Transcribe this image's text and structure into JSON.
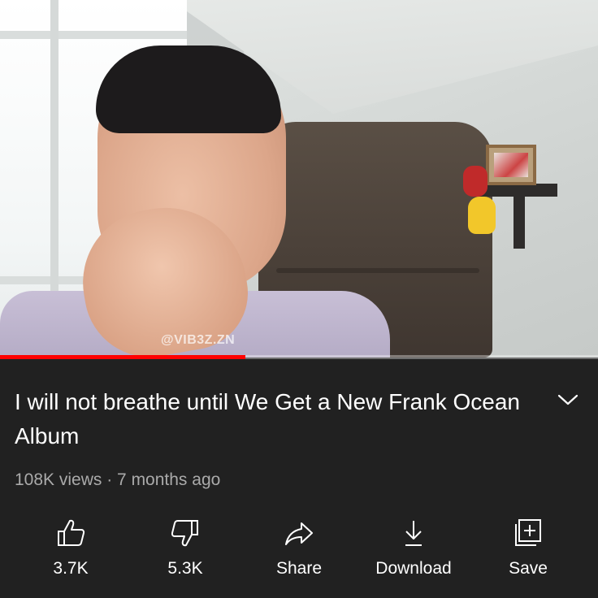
{
  "video": {
    "watermark": "@VIB3Z.ZN",
    "progress_fraction": 0.41
  },
  "info": {
    "title": "I will not breathe until We Get a New Frank Ocean Album",
    "meta": "108K views · 7 months ago",
    "expand_icon": "chevron-down-icon"
  },
  "actions": [
    {
      "label": "3.7K",
      "icon": "thumbs-up-icon"
    },
    {
      "label": "5.3K",
      "icon": "thumbs-down-icon"
    },
    {
      "label": "Share",
      "icon": "share-arrow-icon"
    },
    {
      "label": "Download",
      "icon": "download-icon"
    },
    {
      "label": "Save",
      "icon": "save-playlist-icon"
    }
  ],
  "colors": {
    "background": "#212121",
    "progress": "#ff0000",
    "meta_text": "#aaaaaa",
    "text": "#ffffff"
  }
}
